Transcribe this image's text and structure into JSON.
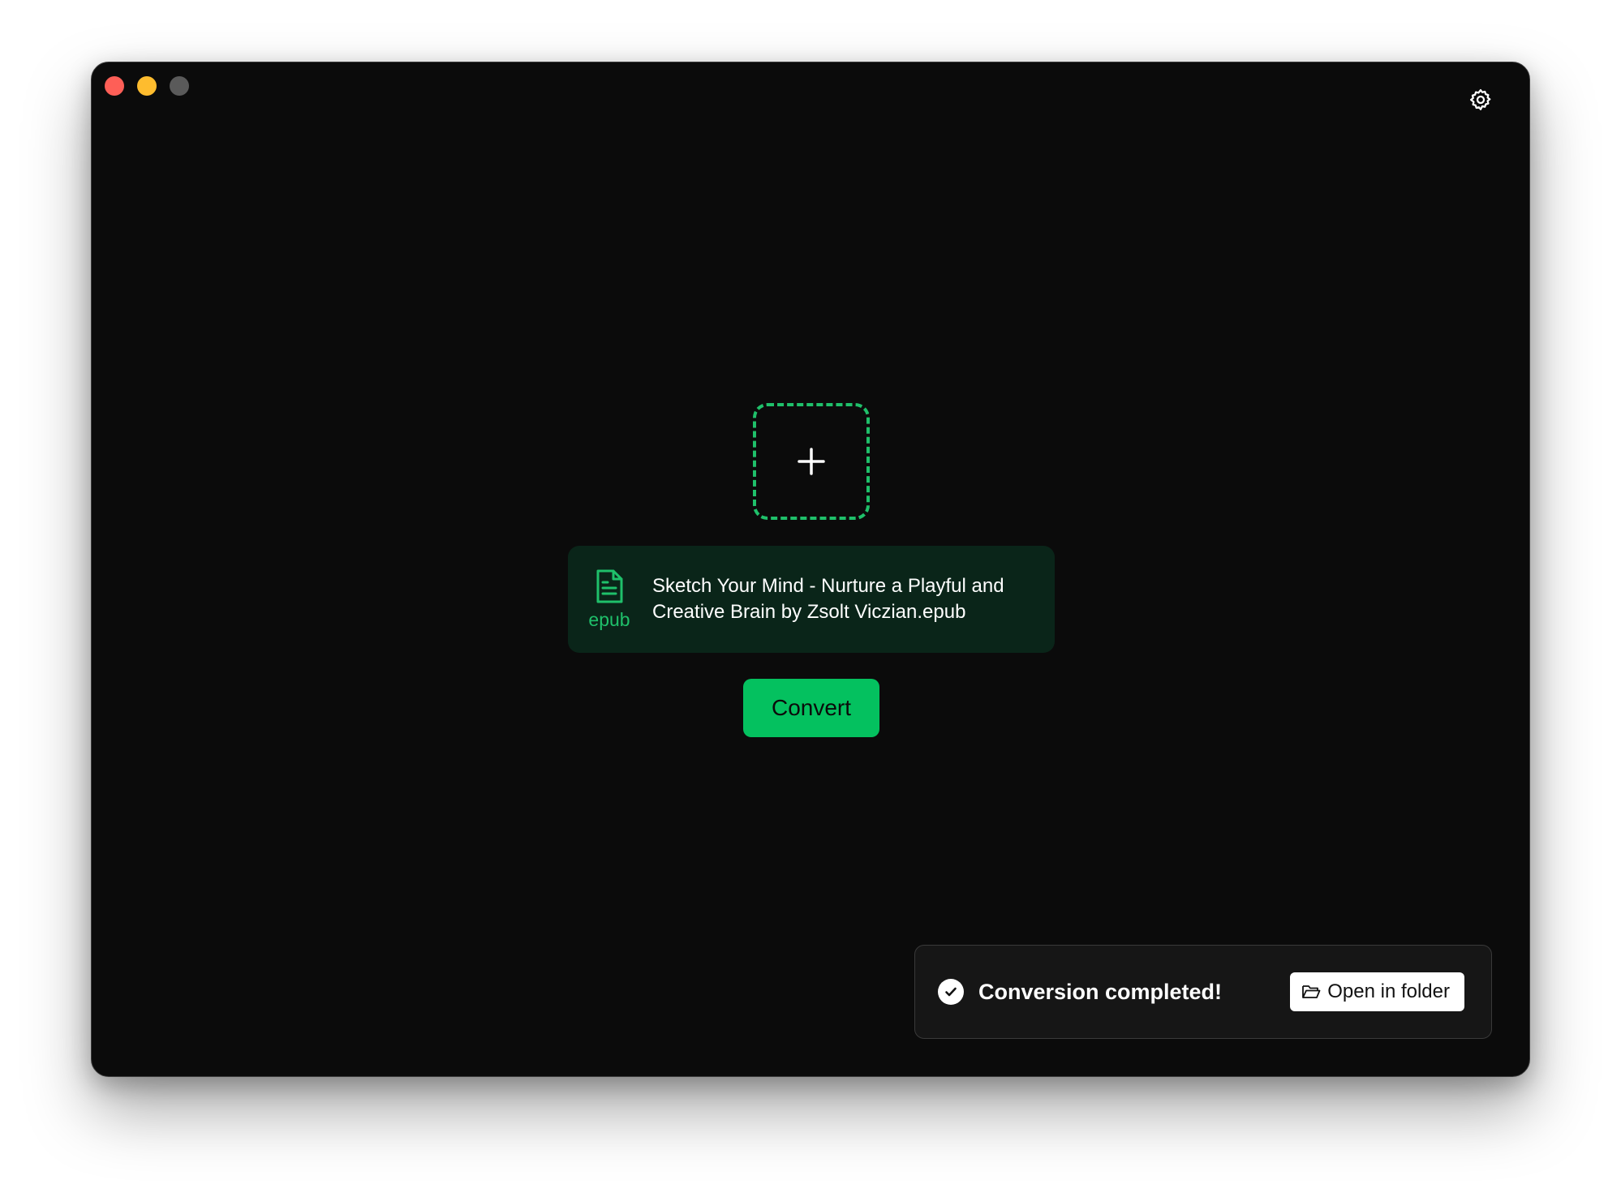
{
  "window": {
    "controls": [
      "close",
      "minimize",
      "maximize"
    ],
    "settings_icon": "gear-icon"
  },
  "dropzone": {
    "icon": "plus-icon",
    "accent_color": "#1fc06a"
  },
  "file": {
    "type_label": "epub",
    "icon": "document-icon",
    "name": "Sketch Your Mind - Nurture a Playful and Creative Brain by Zsolt Viczian.epub"
  },
  "actions": {
    "convert_label": "Convert",
    "convert_color": "#04c15f"
  },
  "toast": {
    "icon": "check-circle-icon",
    "message": "Conversion completed!",
    "button_icon": "folder-open-icon",
    "button_label": "Open in folder"
  }
}
